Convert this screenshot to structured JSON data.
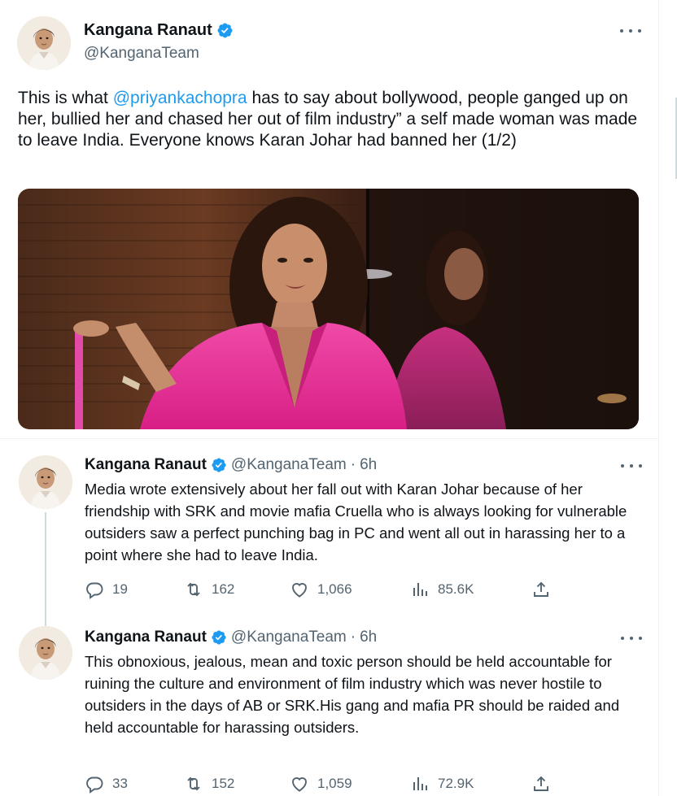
{
  "main_tweet": {
    "author_name": "Kangana Ranaut",
    "author_handle": "@KanganaTeam",
    "text_before": "This is what ",
    "mention": "@priyankachopra",
    "text_after": " has to say about bollywood, people ganged up on her, bullied her and chased her out of film industry” a self made woman was made to leave India. Everyone knows Karan Johar had banned her (1/2)",
    "avatar_icon": "profile-photo",
    "more_icon": "more-icon",
    "photo_icon": "tweet-photo"
  },
  "replies": [
    {
      "author_name": "Kangana Ranaut",
      "author_handle": "@KanganaTeam",
      "separator": "·",
      "time": "6h",
      "text": "Media wrote extensively about her fall out with Karan Johar because of her friendship with SRK and movie mafia Cruella who is always looking for vulnerable outsiders saw a perfect punching bag in PC and went all out in harassing her to a point where she had to leave India.",
      "replies_count": "19",
      "retweets_count": "162",
      "likes_count": "1,066",
      "views_count": "85.6K"
    },
    {
      "author_name": "Kangana Ranaut",
      "author_handle": "@KanganaTeam",
      "separator": "·",
      "time": "6h",
      "text": "This obnoxious, jealous, mean and toxic person should be held accountable for ruining the culture and environment of film industry which was never hostile to outsiders in the days of AB or SRK.His gang and mafia PR should be raided and held accountable for harassing outsiders.",
      "replies_count": "33",
      "retweets_count": "152",
      "likes_count": "1,059",
      "views_count": "72.9K"
    }
  ],
  "colors": {
    "link": "#1d9bf0",
    "secondary_text": "#536471",
    "primary_text": "#0f1419",
    "verified": "#1d9bf0",
    "pink_outfit": "#e8319a"
  },
  "icons": [
    "verified-badge-icon",
    "reply-icon",
    "retweet-icon",
    "like-icon",
    "views-icon",
    "share-icon",
    "more-icon"
  ]
}
